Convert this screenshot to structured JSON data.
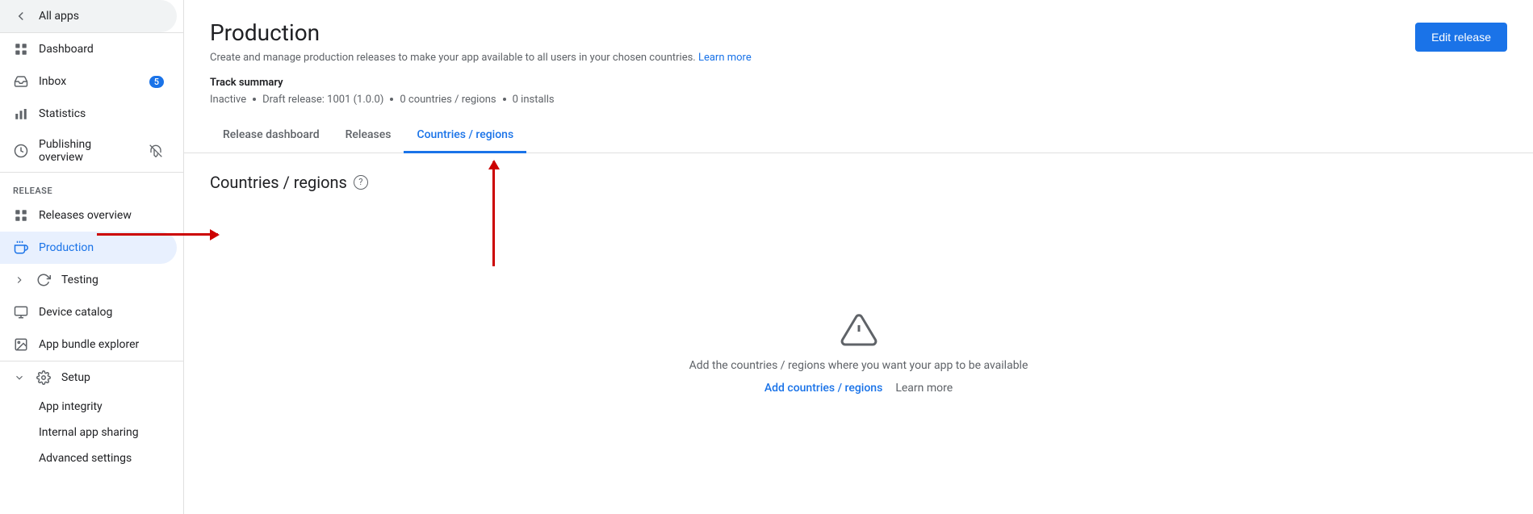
{
  "sidebar": {
    "all_apps_label": "All apps",
    "nav_items": [
      {
        "id": "dashboard",
        "label": "Dashboard",
        "icon": "grid",
        "badge": null,
        "active": false
      },
      {
        "id": "inbox",
        "label": "Inbox",
        "icon": "inbox",
        "badge": "5",
        "active": false
      },
      {
        "id": "statistics",
        "label": "Statistics",
        "icon": "bar-chart",
        "badge": null,
        "active": false
      },
      {
        "id": "publishing-overview",
        "label": "Publishing overview",
        "icon": "clock",
        "badge": null,
        "active": false
      }
    ],
    "release_section_label": "Release",
    "release_items": [
      {
        "id": "releases-overview",
        "label": "Releases overview",
        "icon": "grid-small",
        "badge": null,
        "active": false,
        "expandable": false
      },
      {
        "id": "production",
        "label": "Production",
        "icon": "bell",
        "badge": null,
        "active": true,
        "expandable": false
      },
      {
        "id": "testing",
        "label": "Testing",
        "icon": "refresh",
        "badge": null,
        "active": false,
        "expandable": true
      },
      {
        "id": "device-catalog",
        "label": "Device catalog",
        "icon": "monitor",
        "badge": null,
        "active": false,
        "expandable": false
      },
      {
        "id": "app-bundle-explorer",
        "label": "App bundle explorer",
        "icon": "image",
        "badge": null,
        "active": false,
        "expandable": false
      }
    ],
    "setup_section_label": "Setup",
    "setup_items": [
      {
        "id": "app-integrity",
        "label": "App integrity"
      },
      {
        "id": "internal-app-sharing",
        "label": "Internal app sharing"
      },
      {
        "id": "advanced-settings",
        "label": "Advanced settings"
      }
    ]
  },
  "header": {
    "title": "Production",
    "subtitle": "Create and manage production releases to make your app available to all users in your chosen countries.",
    "learn_more_label": "Learn more",
    "edit_release_label": "Edit release"
  },
  "track_summary": {
    "title": "Track summary",
    "status": "Inactive",
    "draft_release": "Draft release: 1001 (1.0.0)",
    "countries": "0 countries / regions",
    "installs": "0 installs"
  },
  "tabs": [
    {
      "id": "release-dashboard",
      "label": "Release dashboard",
      "active": false
    },
    {
      "id": "releases",
      "label": "Releases",
      "active": false
    },
    {
      "id": "countries-regions",
      "label": "Countries / regions",
      "active": true
    }
  ],
  "content": {
    "section_title": "Countries / regions",
    "empty_state_text": "Add the countries / regions where you want your app to be available",
    "add_link_label": "Add countries / regions",
    "learn_more_label": "Learn more"
  }
}
